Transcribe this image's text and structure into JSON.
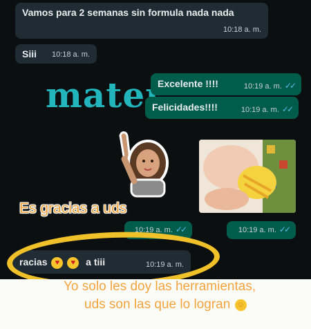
{
  "messages": [
    {
      "text": "Vamos para 2 semanas sin formula nada nada",
      "time": "10:18 a. m."
    },
    {
      "text": "Siii",
      "time": "10:18 a. m."
    },
    {
      "text": "Excelente !!!!",
      "time": "10:19 a. m."
    },
    {
      "text": "Felicidades!!!!",
      "time": "10:19 a. m."
    },
    {
      "time": "10:19 a. m."
    },
    {
      "time": "10:19 a. m."
    },
    {
      "text_prefix": "racias",
      "text_suffix": "a tiii",
      "time": "10:19 a. m."
    }
  ],
  "logo_text": "mater",
  "overlay": {
    "caption_top": "Es gracias a uds",
    "caption_bottom_1": "Yo solo les doy las herramientas,",
    "caption_bottom_2": "uds son las que lo logran"
  },
  "icons": {
    "ticks": "double-check-icon",
    "emoji_1": "smiling-face-with-hearts-icon",
    "emoji_2": "heart-eyes-icon",
    "emoji_3": "hugging-face-icon"
  },
  "colors": {
    "incoming": "#1f2c33",
    "outgoing": "#005c4b",
    "logo": "#22b5bc",
    "caption": "#f3a23a",
    "highlight": "#f1c12a"
  }
}
